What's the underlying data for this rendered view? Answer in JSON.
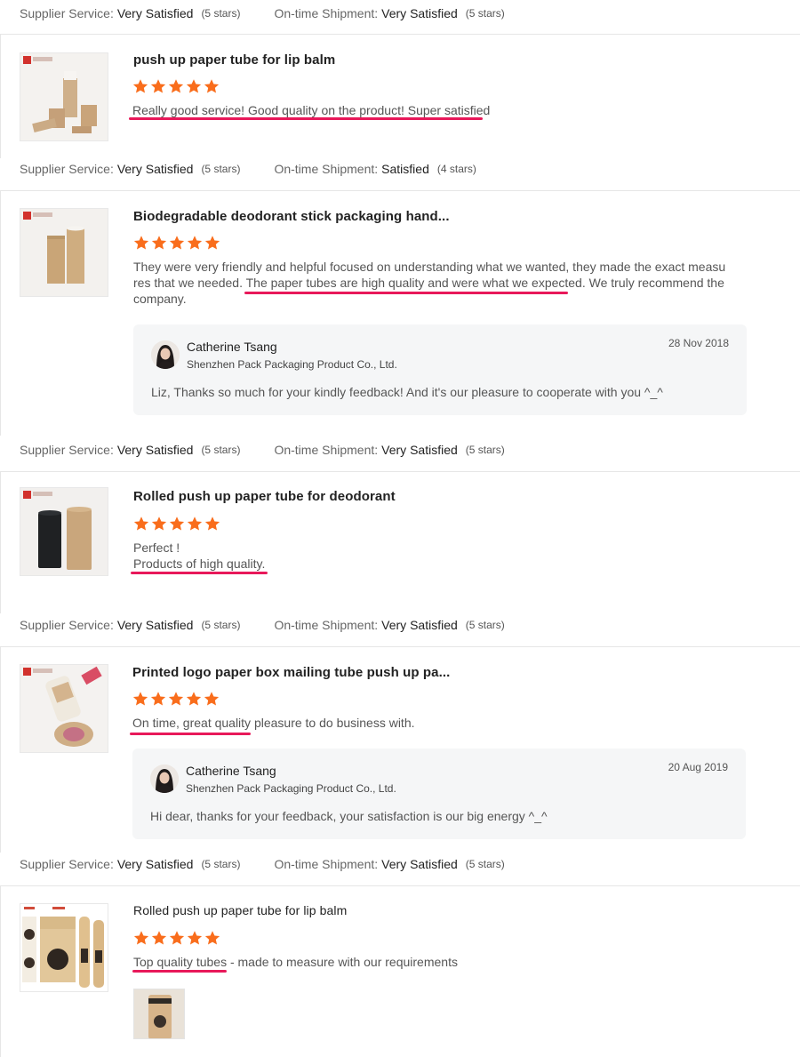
{
  "labels": {
    "supplier_service": "Supplier Service:",
    "ontime_shipment": "On-time Shipment:"
  },
  "colors": {
    "star": "#f96d1c",
    "underline": "#e8195a"
  },
  "ratings": [
    {
      "service": "Very Satisfied",
      "service_stars": "(5 stars)",
      "shipment": "Very Satisfied",
      "shipment_stars": "(5 stars)"
    },
    {
      "service": "Very Satisfied",
      "service_stars": "(5 stars)",
      "shipment": "Satisfied",
      "shipment_stars": "(4 stars)"
    },
    {
      "service": "Very Satisfied",
      "service_stars": "(5 stars)",
      "shipment": "Very Satisfied",
      "shipment_stars": "(5 stars)"
    },
    {
      "service": "Very Satisfied",
      "service_stars": "(5 stars)",
      "shipment": "Very Satisfied",
      "shipment_stars": "(5 stars)"
    },
    {
      "service": "Very Satisfied",
      "service_stars": "(5 stars)",
      "shipment": "Very Satisfied",
      "shipment_stars": "(5 stars)"
    }
  ],
  "reviews": [
    {
      "product": "push up paper tube for lip balm",
      "rating": 5,
      "text": "Really good service! Good quality on the product! Super satisfied"
    },
    {
      "product": "Biodegradable deodorant stick packaging hand...",
      "rating": 5,
      "text_line1": "They were very friendly and helpful focused on understanding what we wanted, they made the exact measu",
      "text_line2": "res that we needed. The paper tubes are high quality and were what we expected. We truly recommend the",
      "text_line3": "company.",
      "reply": {
        "name": "Catherine Tsang",
        "company": "Shenzhen Pack Packaging Product Co., Ltd.",
        "date": "28 Nov 2018",
        "message": "Liz, Thanks so much for your kindly feedback! And it's our pleasure to cooperate with you ^_^"
      }
    },
    {
      "product": "Rolled push up paper tube for deodorant",
      "rating": 5,
      "text_line1": "Perfect !",
      "text_line2": "Products of high quality."
    },
    {
      "product": "Printed logo paper box mailing tube push up pa...",
      "rating": 5,
      "text": "On time, great quality pleasure to do business with.",
      "reply": {
        "name": "Catherine Tsang",
        "company": "Shenzhen Pack Packaging Product Co., Ltd.",
        "date": "20 Aug 2019",
        "message": "Hi dear, thanks for your feedback, your satisfaction is our big energy ^_^"
      }
    },
    {
      "product": "Rolled push up paper tube for lip balm",
      "rating": 5,
      "text": "Top quality tubes - made to measure with our requirements"
    }
  ]
}
